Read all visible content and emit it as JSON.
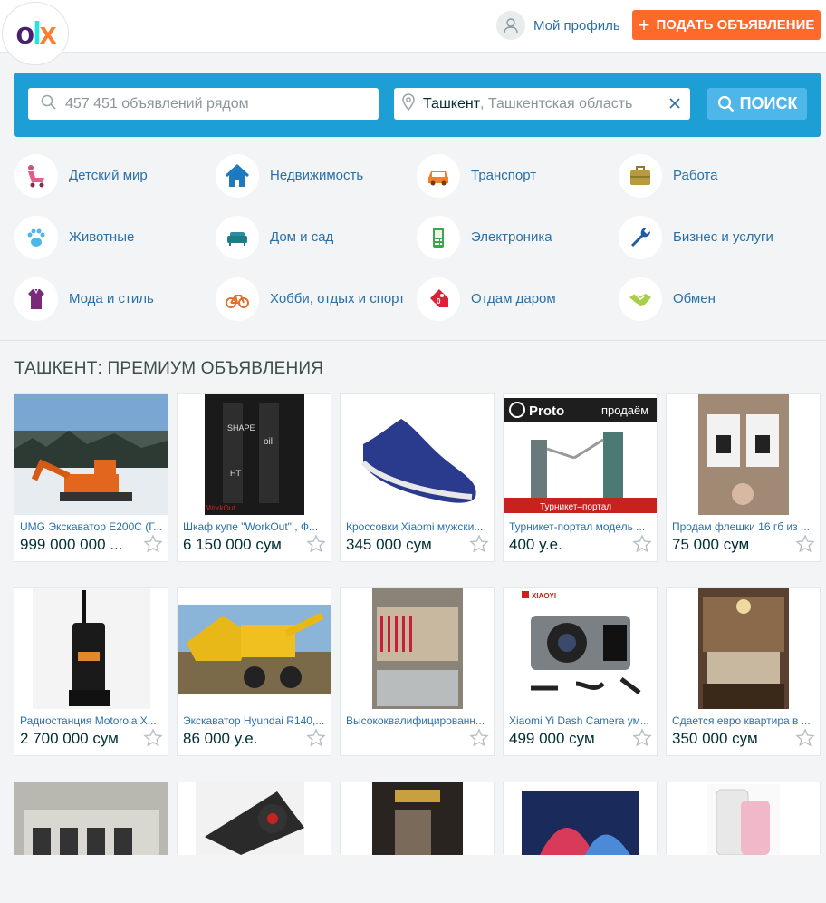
{
  "header": {
    "logo_text": "OLX",
    "profile_label": "Мой профиль",
    "post_button_label": "ПОДАТЬ ОБЪЯВЛЕНИЕ",
    "accent_color": "#ff6a2a"
  },
  "search": {
    "placeholder": "457 451 объявлений рядом",
    "location_city": "Ташкент",
    "location_region": ", Ташкентская область",
    "button_label": "ПОИСК",
    "panel_color": "#1d9ed4"
  },
  "categories": [
    {
      "label": "Детский мир",
      "icon": "stroller-icon"
    },
    {
      "label": "Недвижимость",
      "icon": "house-icon"
    },
    {
      "label": "Транспорт",
      "icon": "car-icon"
    },
    {
      "label": "Работа",
      "icon": "briefcase-icon"
    },
    {
      "label": "Животные",
      "icon": "paw-icon"
    },
    {
      "label": "Дом и сад",
      "icon": "sofa-icon"
    },
    {
      "label": "Электроника",
      "icon": "phone-icon"
    },
    {
      "label": "Бизнес и услуги",
      "icon": "wrench-icon"
    },
    {
      "label": "Мода и стиль",
      "icon": "dress-icon"
    },
    {
      "label": "Хобби, отдых и спорт",
      "icon": "bicycle-icon"
    },
    {
      "label": "Отдам даром",
      "icon": "price-tag-icon"
    },
    {
      "label": "Обмен",
      "icon": "handshake-icon"
    }
  ],
  "section_title": "ТАШКЕНТ: ПРЕМИУМ ОБЪЯВЛЕНИЯ",
  "listings": [
    {
      "title": "UMG Экскаватор E200C (Г...",
      "price": "999 000 000 ...",
      "image": "excavator-photo"
    },
    {
      "title": "Шкаф купе \"WorkOut\" , Ф...",
      "price": "6 150 000 сум",
      "image": "wardrobe-photo"
    },
    {
      "title": "Кроссовки Xiaomi мужски...",
      "price": "345 000 сум",
      "image": "sneaker-photo"
    },
    {
      "title": "Турникет-портал модель ...",
      "price": "400 у.е.",
      "image": "turnstile-photo"
    },
    {
      "title": "Продам флешки 16 гб из ...",
      "price": "75 000 сум",
      "image": "flash-drive-photo"
    },
    {
      "title": "Радиостанция Motorola X...",
      "price": "2 700 000 сум",
      "image": "radio-photo"
    },
    {
      "title": "Экскаватор Hyundai R140,...",
      "price": "86 000 у.е.",
      "image": "hyundai-excavator-photo"
    },
    {
      "title": "Высококвалифицированн...",
      "price": "",
      "image": "workshop-photo"
    },
    {
      "title": "Xiaomi Yi Dash Camera ум...",
      "price": "499 000 сум",
      "image": "dashcam-photo"
    },
    {
      "title": "Сдается евро квартира в ...",
      "price": "350 000 сум",
      "image": "bedroom-photo"
    }
  ],
  "banner_texts": {
    "proto_brand": "Proto",
    "proto_tag": "продаём",
    "proto_caption": "Турникет–портал",
    "dashcam_brand": "XIAOYI"
  }
}
